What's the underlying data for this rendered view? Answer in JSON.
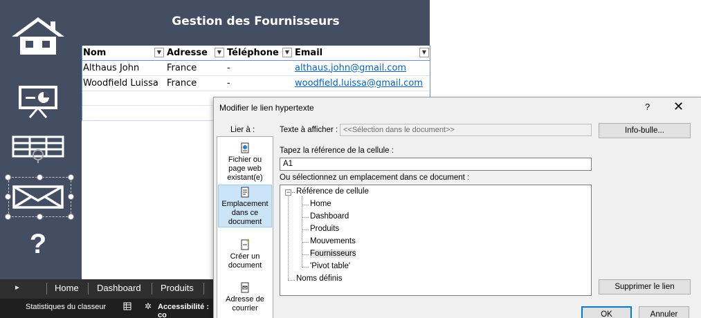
{
  "sheet": {
    "title": "Gestion des Fournisseurs",
    "columns": [
      "Nom",
      "Adresse",
      "Téléphone",
      "Email"
    ],
    "rows": [
      {
        "nom": "Althaus John",
        "adresse": "France",
        "telephone": "-",
        "email": "althaus.john@gmail.com"
      },
      {
        "nom": "Woodfield Luissa",
        "adresse": "France",
        "telephone": "-",
        "email": "woodfield.luissa@gmail.com"
      }
    ]
  },
  "nav": {
    "items": [
      "home-icon",
      "presentation-chart-icon",
      "table-icon",
      "mail-icon",
      "help-icon"
    ],
    "help_glyph": "?"
  },
  "sheet_tabs": {
    "arrow": "►",
    "items": [
      "Home",
      "Dashboard",
      "Produits"
    ]
  },
  "statusbar": {
    "stats": "Statistiques du classeur",
    "accessibility": "Accessibilité : co"
  },
  "dialog": {
    "title": "Modifier le lien hypertexte",
    "help": "?",
    "close": "✕",
    "link_to_label": "Lier à :",
    "text_label": "Texte à afficher :",
    "text_value": "<<Sélection dans le document>>",
    "tooltip_button": "Info-bulle...",
    "cell_ref_label": "Tapez la référence de la cellule :",
    "cell_ref_value": "A1",
    "location_label": "Ou sélectionnez un emplacement dans ce document :",
    "link_types": [
      {
        "line1": "Fichier ou",
        "line2": "page web",
        "line3": "existant(e)"
      },
      {
        "line1": "Emplacement",
        "line2": "dans ce",
        "line3": "document"
      },
      {
        "line1": "Créer un",
        "line2": "document",
        "line3": ""
      },
      {
        "line1": "Adresse de",
        "line2": "courrier",
        "line3": ""
      }
    ],
    "tree": {
      "root": "Référence de cellule",
      "expander": "−",
      "sheets": [
        "Home",
        "Dashboard",
        "Produits",
        "Mouvements",
        "Fournisseurs",
        "'Pivot table'"
      ],
      "names": "Noms définis"
    },
    "remove_link_button": "Supprimer le lien",
    "ok_button": "OK",
    "cancel_button": "Annuler"
  }
}
